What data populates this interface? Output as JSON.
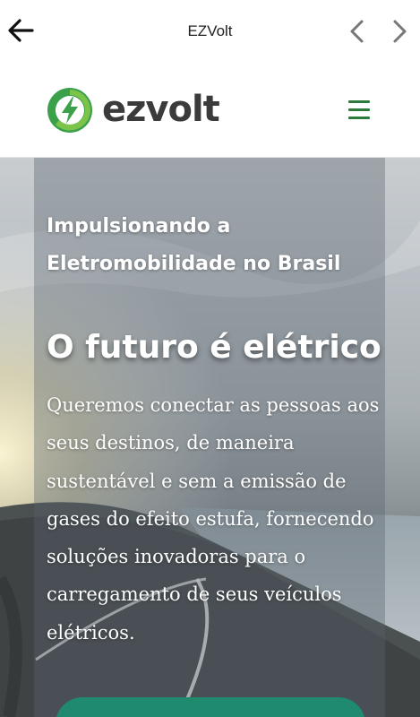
{
  "browser": {
    "title": "EZVolt"
  },
  "header": {
    "logo_text": "ezvolt",
    "brand_green": "#3aa04a",
    "accent_green": "#2b7a3a"
  },
  "hero": {
    "subtitle": "Impulsionando a Eletromobilidade no Brasil",
    "headline": "O futuro é elétrico",
    "body": "Queremos conectar as pessoas aos seus destinos, de maneira sustentável e sem a emissão de gases do efeito estufa, fornecendo soluções inovadoras para o carregamento de seus veículos elétricos.",
    "cta_color": "#1f8a6e"
  },
  "icons": {
    "back": "arrow-left-icon",
    "prev": "chevron-left-icon",
    "next": "chevron-right-icon",
    "menu": "hamburger-menu-icon",
    "logo": "lightning-bolt-icon"
  }
}
